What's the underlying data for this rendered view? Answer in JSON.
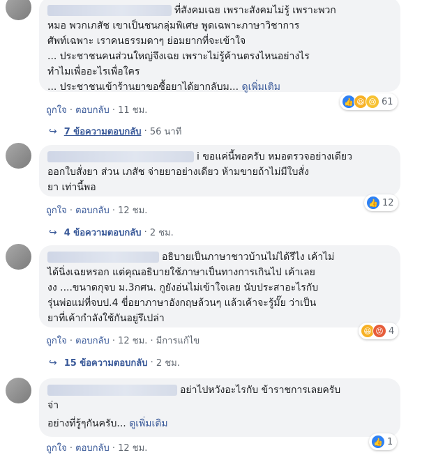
{
  "comments": [
    {
      "lines": [
        "ที่สังคมเฉย เพราะสังคมไม่รู้ เพราะพวก",
        "หมอ พวกเภสัช เขาเป็นชนกลุ่มพิเศษ พูดเฉพาะภาษาวิชาการ",
        "ศัพท์เฉพาะ เราคนธรรมดาๆ ย่อมยากที่จะเข้าใจ",
        "... ประชาชนคนส่วนใหญ่จึงเฉย เพราะไม่รู้ค้านตรงไหนอย่างไร",
        "ทำไมเพื่ออะไรเพื่อใคร"
      ],
      "last_line": "... ประชาชนเข้าร้านยาขอซื้อยาได้ยากลับม...",
      "see_more": "ดูเพิ่มเติม",
      "reaction_count": "61",
      "like": "ถูกใจ",
      "reply": "ตอบกลับ",
      "time": "11 ชม.",
      "replies_label": "7 ข้อความตอบกลับ",
      "replies_time": "56 นาที"
    },
    {
      "lines": [
        "i ขอแค่นี้พอครับ หมอตรวจอย่างเดียว",
        "ออกใบสั่งยา ส่วน เภสัช จ่ายยาอย่างเดียว ห้ามขายถ้าไม่มีใบสั่ง",
        "ยา เท่านี้พอ"
      ],
      "reaction_count": "12",
      "like": "ถูกใจ",
      "reply": "ตอบกลับ",
      "time": "12 ชม.",
      "replies_label": "4 ข้อความตอบกลับ",
      "replies_time": "2 ชม."
    },
    {
      "lines": [
        "อธิบายเป็นภาษาชาวบ้านไม่ได้รึไง เค้าไม่",
        "ได้นิ่งเฉยหรอก แต่คุณอธิบายใช้ภาษาเป็นทางการเกินไป เค้าเลย",
        "งง ....ขนาดกุจบ ม.3กศน. กูยังอ่นไม่เข้าใจเลย นับประสาอะไรกับ",
        "รุ่นพ่อแม่ที่จบป.4 ขี่อยาภาษาอังกฤษล้วนๆ แล้วเค้าจะรู้มั๊ย ว่าเป็น",
        "ยาที่เค้ากำลังใช้กันอยู่รึเปล่า"
      ],
      "reaction_count": "4",
      "like": "ถูกใจ",
      "reply": "ตอบกลับ",
      "time": "12 ชม.",
      "edited": "มีการแก้ไข",
      "replies_label": "15 ข้อความตอบกลับ",
      "replies_time": "2 ชม."
    },
    {
      "lines": [
        "อย่าไปหวังอะไรกับ ข้าราชการเลยครับ",
        "จ่า"
      ],
      "last_line": "อย่างที่รู้ๆกันครับ...",
      "see_more": "ดูเพิ่มเติม",
      "reaction_count": "1",
      "like": "ถูกใจ",
      "reply": "ตอบกลับ",
      "time": "12 ชม."
    }
  ],
  "icons": {
    "like": "like-icon",
    "haha": "haha-icon",
    "sad": "sad-icon",
    "angry": "angry-icon",
    "reply_arrow": "reply-arrow-icon"
  }
}
